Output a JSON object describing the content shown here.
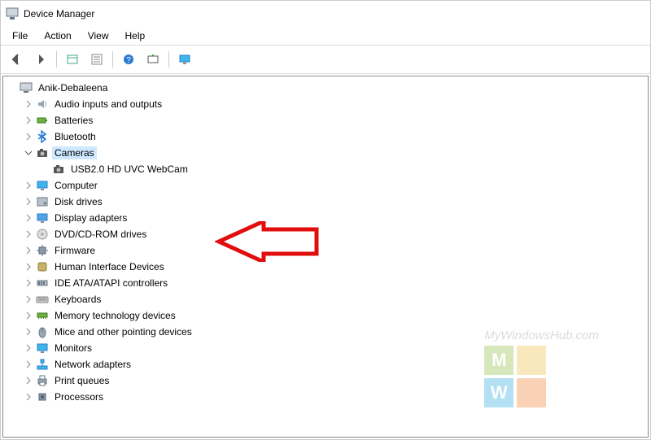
{
  "window": {
    "title": "Device Manager"
  },
  "menu": {
    "file": "File",
    "action": "Action",
    "view": "View",
    "help": "Help"
  },
  "toolbar_icons": {
    "back": "back-arrow",
    "forward": "forward-arrow",
    "up": "show-containers",
    "properties": "properties",
    "help": "help",
    "scan": "scan-hardware",
    "monitor": "monitor"
  },
  "root": {
    "expanded": true,
    "label": "Anik-Debaleena",
    "icon": "computer",
    "children": [
      {
        "label": "Audio inputs and outputs",
        "icon": "speaker",
        "expanded": false,
        "hasChildren": true
      },
      {
        "label": "Batteries",
        "icon": "battery",
        "expanded": false,
        "hasChildren": true
      },
      {
        "label": "Bluetooth",
        "icon": "bluetooth",
        "expanded": false,
        "hasChildren": true
      },
      {
        "label": "Cameras",
        "icon": "camera",
        "expanded": true,
        "hasChildren": true,
        "selected": true,
        "children": [
          {
            "label": "USB2.0 HD UVC WebCam",
            "icon": "camera",
            "hasChildren": false
          }
        ]
      },
      {
        "label": "Computer",
        "icon": "monitor",
        "expanded": false,
        "hasChildren": true
      },
      {
        "label": "Disk drives",
        "icon": "disk",
        "expanded": false,
        "hasChildren": true
      },
      {
        "label": "Display adapters",
        "icon": "display",
        "expanded": false,
        "hasChildren": true
      },
      {
        "label": "DVD/CD-ROM drives",
        "icon": "cd",
        "expanded": false,
        "hasChildren": true
      },
      {
        "label": "Firmware",
        "icon": "chip",
        "expanded": false,
        "hasChildren": true
      },
      {
        "label": "Human Interface Devices",
        "icon": "hid",
        "expanded": false,
        "hasChildren": true
      },
      {
        "label": "IDE ATA/ATAPI controllers",
        "icon": "ide",
        "expanded": false,
        "hasChildren": true
      },
      {
        "label": "Keyboards",
        "icon": "keyboard",
        "expanded": false,
        "hasChildren": true
      },
      {
        "label": "Memory technology devices",
        "icon": "memory",
        "expanded": false,
        "hasChildren": true
      },
      {
        "label": "Mice and other pointing devices",
        "icon": "mouse",
        "expanded": false,
        "hasChildren": true
      },
      {
        "label": "Monitors",
        "icon": "monitor",
        "expanded": false,
        "hasChildren": true
      },
      {
        "label": "Network adapters",
        "icon": "network",
        "expanded": false,
        "hasChildren": true
      },
      {
        "label": "Print queues",
        "icon": "printer",
        "expanded": false,
        "hasChildren": true
      },
      {
        "label": "Processors",
        "icon": "cpu",
        "expanded": false,
        "hasChildren": true
      }
    ]
  },
  "watermark": {
    "text": "MyWindowsHub.com",
    "letters": [
      "M",
      "",
      "W",
      ""
    ]
  },
  "annotation": {
    "arrow_color": "#e20e0e"
  }
}
